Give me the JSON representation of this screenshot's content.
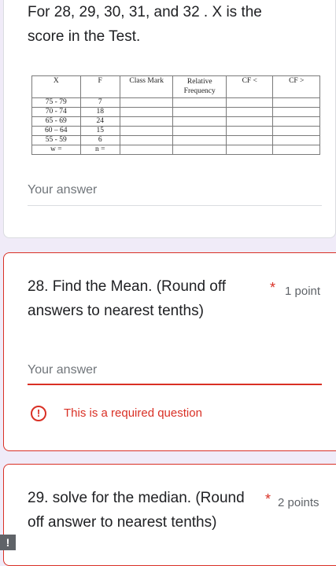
{
  "intro": {
    "text": "For 28, 29, 30, 31, and 32 . X is the score in the Test."
  },
  "table": {
    "headers": [
      "X",
      "F",
      "Class Mark",
      "Relative Frequency",
      "CF <",
      "CF >"
    ],
    "rows": [
      [
        "75 - 79",
        "7"
      ],
      [
        "70 - 74",
        "18"
      ],
      [
        "65 - 69",
        "24"
      ],
      [
        "60 – 64",
        "15"
      ],
      [
        "55 - 59",
        "6"
      ],
      [
        "w =",
        "n ="
      ]
    ]
  },
  "intro_answer": {
    "placeholder": "Your answer"
  },
  "q28": {
    "title": "28. Find the Mean. (Round off answers to nearest tenths)",
    "required_mark": "*",
    "points": "1 point",
    "answer_placeholder": "Your answer",
    "error": "This is a required question",
    "error_icon": "!"
  },
  "q29": {
    "title": "29. solve for the median. (Round off answer to nearest tenths)",
    "required_mark": "*",
    "points": "2 points"
  },
  "colors": {
    "error": "#d93025",
    "background": "#f0ebf8"
  }
}
